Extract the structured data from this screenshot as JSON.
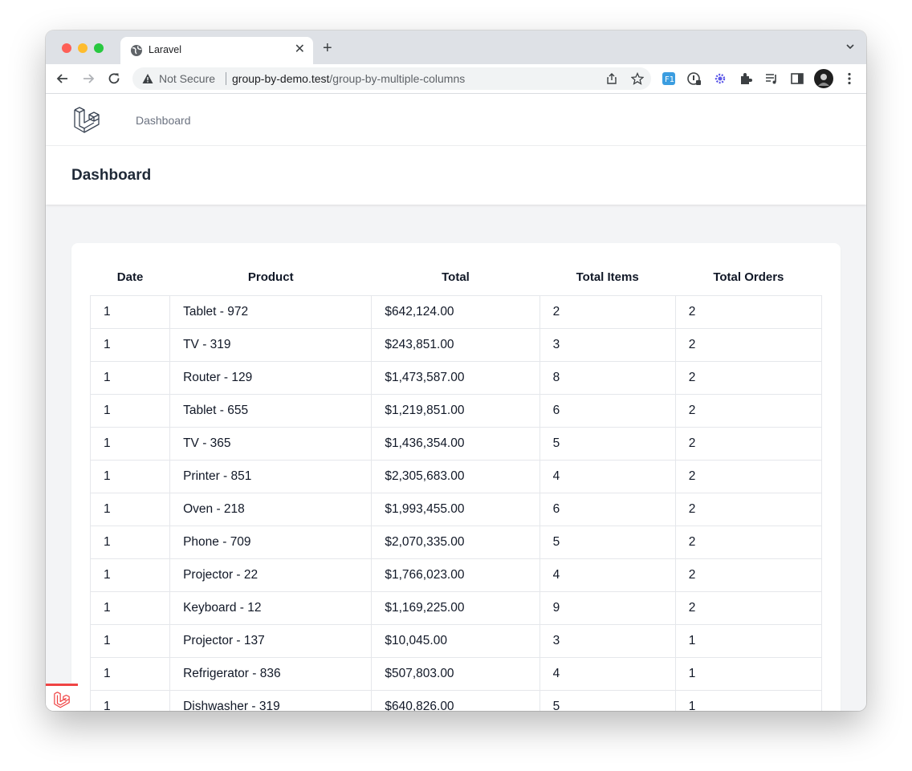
{
  "browser": {
    "tab_title": "Laravel",
    "new_tab_symbol": "+",
    "close_symbol": "✕",
    "security_label": "Not Secure",
    "url_host": "group-by-demo.test",
    "url_path": "/group-by-multiple-columns",
    "extension_icons": [
      "formula-extension-icon",
      "password-manager-icon",
      "gear-puzzle-extension-icon",
      "extensions-puzzle-icon",
      "media-controls-icon",
      "side-panel-icon",
      "profile-avatar",
      "browser-menu-icon"
    ]
  },
  "nav": {
    "link_dashboard": "Dashboard"
  },
  "header": {
    "title": "Dashboard"
  },
  "table": {
    "columns": [
      "Date",
      "Product",
      "Total",
      "Total Items",
      "Total Orders"
    ],
    "rows": [
      [
        "1",
        "Tablet - 972",
        "$642,124.00",
        "2",
        "2"
      ],
      [
        "1",
        "TV - 319",
        "$243,851.00",
        "3",
        "2"
      ],
      [
        "1",
        "Router - 129",
        "$1,473,587.00",
        "8",
        "2"
      ],
      [
        "1",
        "Tablet - 655",
        "$1,219,851.00",
        "6",
        "2"
      ],
      [
        "1",
        "TV - 365",
        "$1,436,354.00",
        "5",
        "2"
      ],
      [
        "1",
        "Printer - 851",
        "$2,305,683.00",
        "4",
        "2"
      ],
      [
        "1",
        "Oven - 218",
        "$1,993,455.00",
        "6",
        "2"
      ],
      [
        "1",
        "Phone - 709",
        "$2,070,335.00",
        "5",
        "2"
      ],
      [
        "1",
        "Projector - 22",
        "$1,766,023.00",
        "4",
        "2"
      ],
      [
        "1",
        "Keyboard - 12",
        "$1,169,225.00",
        "9",
        "2"
      ],
      [
        "1",
        "Projector - 137",
        "$10,045.00",
        "3",
        "1"
      ],
      [
        "1",
        "Refrigerator - 836",
        "$507,803.00",
        "4",
        "1"
      ],
      [
        "1",
        "Dishwasher - 319",
        "$640,826.00",
        "5",
        "1"
      ]
    ]
  },
  "colors": {
    "accent_red": "#ef4444",
    "page_bg": "#f3f4f6"
  }
}
